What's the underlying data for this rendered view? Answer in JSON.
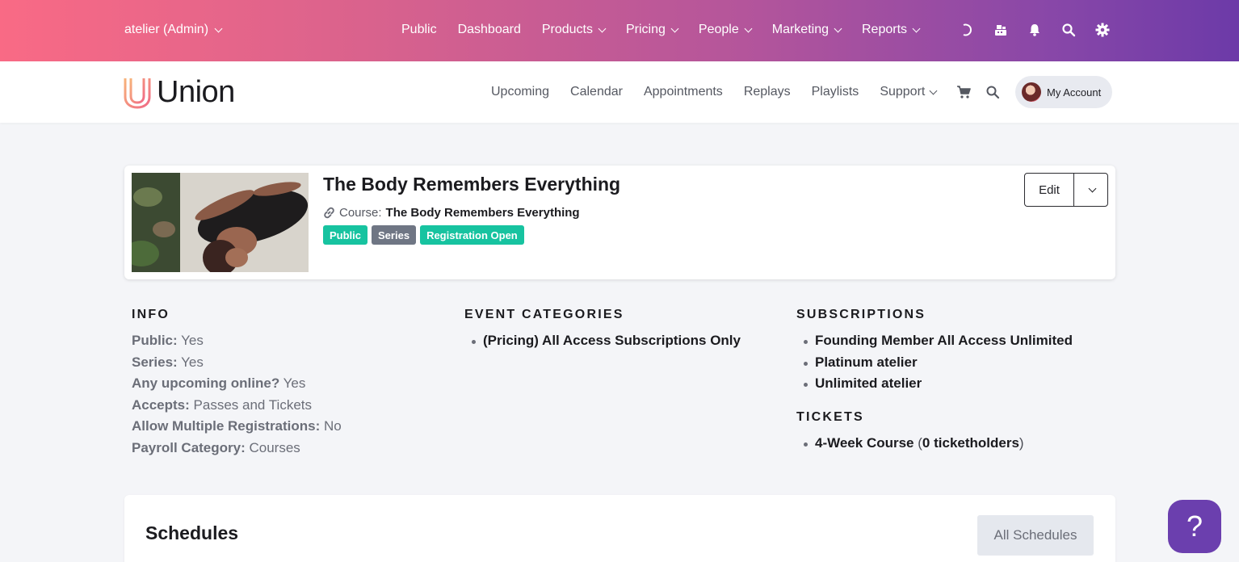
{
  "admin_bar": {
    "org_label": "atelier (Admin)",
    "nav": [
      "Public",
      "Dashboard",
      "Products",
      "Pricing",
      "People",
      "Marketing",
      "Reports"
    ],
    "nav_has_dropdown": [
      false,
      false,
      true,
      true,
      true,
      true,
      true
    ],
    "icons": [
      "loading-icon",
      "register-icon",
      "bell-icon",
      "search-icon",
      "gear-icon"
    ]
  },
  "site_header": {
    "logo_text": "Union",
    "nav": [
      "Upcoming",
      "Calendar",
      "Appointments",
      "Replays",
      "Playlists",
      "Support"
    ],
    "nav_has_dropdown": [
      false,
      false,
      false,
      false,
      false,
      true
    ],
    "account_label": "My Account"
  },
  "event": {
    "title": "The Body Remembers Everything",
    "course_prefix": "Course:",
    "course_name": "The Body Remembers Everything",
    "badges": [
      {
        "label": "Public",
        "color": "#17c3a0"
      },
      {
        "label": "Series",
        "color": "#6f7684"
      },
      {
        "label": "Registration Open",
        "color": "#17c3a0"
      }
    ],
    "edit_label": "Edit"
  },
  "info": {
    "heading": "INFO",
    "rows": [
      {
        "label": "Public:",
        "value": "Yes"
      },
      {
        "label": "Series:",
        "value": "Yes"
      },
      {
        "label": "Any upcoming online?",
        "value": "Yes"
      },
      {
        "label": "Accepts:",
        "value": "Passes and Tickets"
      },
      {
        "label": "Allow Multiple Registrations:",
        "value": "No"
      },
      {
        "label": "Payroll Category:",
        "value": "Courses"
      }
    ]
  },
  "event_categories": {
    "heading": "EVENT CATEGORIES",
    "items": [
      "(Pricing) All Access Subscriptions Only"
    ]
  },
  "subscriptions": {
    "heading": "SUBSCRIPTIONS",
    "items": [
      "Founding Member All Access Unlimited",
      "Platinum atelier",
      "Unlimited atelier"
    ]
  },
  "tickets": {
    "heading": "TICKETS",
    "items": [
      {
        "name": "4-Week Course",
        "holders": "0 ticketholders"
      }
    ]
  },
  "schedules": {
    "title": "Schedules",
    "all_label": "All Schedules"
  },
  "help": {
    "symbol": "?"
  }
}
